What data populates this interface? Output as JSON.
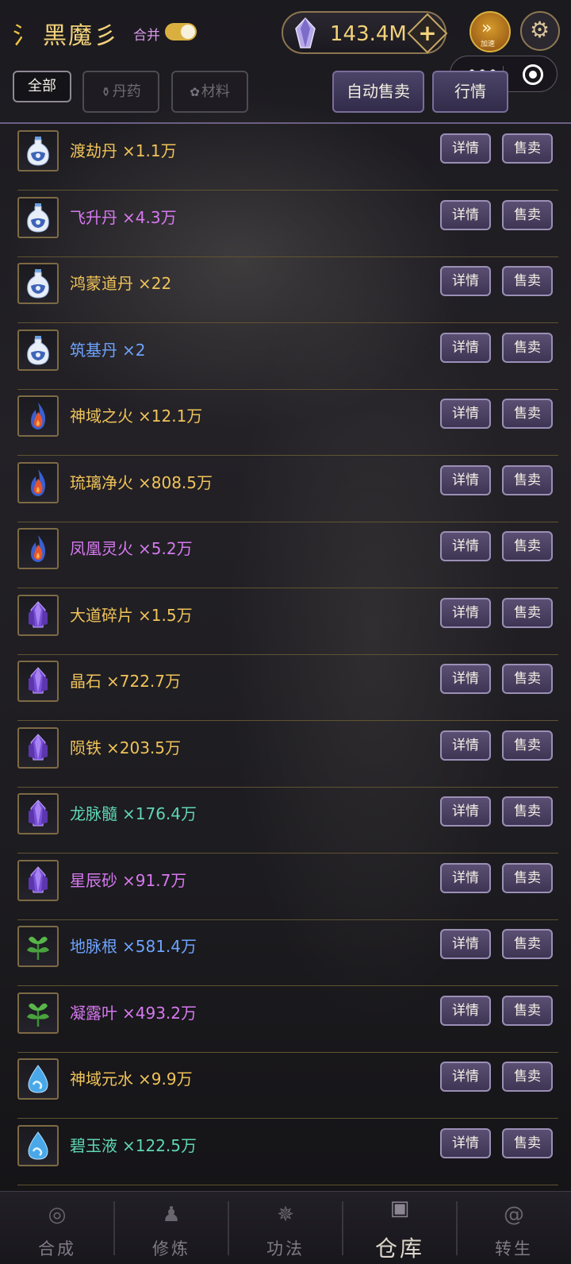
{
  "header": {
    "logo_glyph": "氵",
    "title": "黑魔彡",
    "merge_label": "合并",
    "merge_enabled": true,
    "currency_value": "143.4M",
    "add_label": "+",
    "speed_label": "加速",
    "speed_glyph": "»",
    "settings_glyph": "⚙"
  },
  "filters": {
    "tabs": [
      {
        "label": "全部",
        "icon": "",
        "active": true
      },
      {
        "label": "丹药",
        "icon": "flask-icon",
        "active": false
      },
      {
        "label": "材料",
        "icon": "sprout-icon",
        "active": false
      }
    ],
    "auto_sell_label": "自动售卖",
    "market_label": "行情"
  },
  "items": [
    {
      "name": "渡劫丹",
      "count": "×1.1万",
      "color": "#f0c35a",
      "icon": "pill-bottle-icon"
    },
    {
      "name": "飞升丹",
      "count": "×4.3万",
      "color": "#d679f0",
      "icon": "pill-bottle-icon"
    },
    {
      "name": "鸿蒙道丹",
      "count": "×22",
      "color": "#f0c35a",
      "icon": "pill-bottle-icon"
    },
    {
      "name": "筑基丹",
      "count": "×2",
      "color": "#6ea3ff",
      "icon": "pill-bottle-icon"
    },
    {
      "name": "神域之火",
      "count": "×12.1万",
      "color": "#f0c35a",
      "icon": "flame-icon"
    },
    {
      "name": "琉璃净火",
      "count": "×808.5万",
      "color": "#f0c35a",
      "icon": "flame-icon"
    },
    {
      "name": "凤凰灵火",
      "count": "×5.2万",
      "color": "#d679f0",
      "icon": "flame-icon"
    },
    {
      "name": "大道碎片",
      "count": "×1.5万",
      "color": "#f0c35a",
      "icon": "crystal-icon"
    },
    {
      "name": "晶石",
      "count": "×722.7万",
      "color": "#f0c35a",
      "icon": "crystal-icon"
    },
    {
      "name": "陨铁",
      "count": "×203.5万",
      "color": "#f0c35a",
      "icon": "crystal-icon"
    },
    {
      "name": "龙脉髓",
      "count": "×176.4万",
      "color": "#5fd6b4",
      "icon": "crystal-icon"
    },
    {
      "name": "星辰砂",
      "count": "×91.7万",
      "color": "#d679f0",
      "icon": "crystal-icon"
    },
    {
      "name": "地脉根",
      "count": "×581.4万",
      "color": "#6ea3ff",
      "icon": "herb-icon"
    },
    {
      "name": "凝露叶",
      "count": "×493.2万",
      "color": "#d679f0",
      "icon": "herb-icon"
    },
    {
      "name": "神域元水",
      "count": "×9.9万",
      "color": "#f0c35a",
      "icon": "water-drop-icon"
    },
    {
      "name": "碧玉液",
      "count": "×122.5万",
      "color": "#5fd6b4",
      "icon": "water-drop-icon"
    }
  ],
  "row_buttons": {
    "detail": "详情",
    "sell": "售卖"
  },
  "nav": [
    {
      "label": "合成",
      "icon": "swirl-icon",
      "active": false
    },
    {
      "label": "修炼",
      "icon": "meditate-icon",
      "active": false
    },
    {
      "label": "功法",
      "icon": "emblem-icon",
      "active": false
    },
    {
      "label": "仓库",
      "icon": "chest-icon",
      "active": true
    },
    {
      "label": "转生",
      "icon": "vortex-icon",
      "active": false
    }
  ],
  "colors": {
    "gold": "#f2d27a",
    "purple_button": "#4b4468",
    "row_separator": "#5f5332"
  }
}
